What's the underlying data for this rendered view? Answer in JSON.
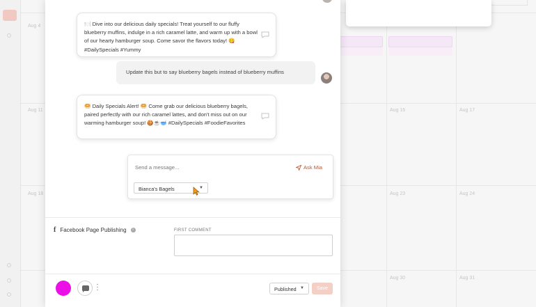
{
  "colors": {
    "accent": "#c0572f",
    "brand_circle": "#ea10e6",
    "save_disabled": "#f4cfc6"
  },
  "calendar": {
    "day_labels": [
      "Aug 4",
      "Aug 11",
      "Aug 16",
      "Aug 17",
      "Aug 18",
      "Aug 23",
      "Aug 24",
      "Aug 30",
      "Aug 31"
    ]
  },
  "chat": {
    "messages": [
      {
        "role": "assistant",
        "text": "🍽️ Dive into our delicious daily specials! Treat yourself to our fluffy blueberry muffins, indulge in a rich caramel latte, and warm up with a bowl of our hearty hamburger soup. Come savor the flavors today! 😋 #DailySpecials #Yummy"
      },
      {
        "role": "user",
        "text": "Update this but to say blueberry bagels instead of blueberry muffins"
      },
      {
        "role": "assistant",
        "text": "🥯 Daily Specials Alert! 🥯 Come grab our delicious blueberry bagels, paired perfectly with our rich caramel lattes, and don't miss out on our warming hamburger soup! 🍪☕🥣 #DailySpecials #FoodieFavorites"
      }
    ],
    "message_icon": "chat-bubble-icon"
  },
  "composer": {
    "placeholder": "Send a message...",
    "ask_label": "Ask Mia",
    "ask_icon": "send-icon",
    "brand_select": "Bianca's Bagels",
    "caret_icon": "chevron-down-icon"
  },
  "publishing": {
    "section_label": "Facebook Page Publishing",
    "section_icon": "facebook-icon",
    "info_icon": "info-icon",
    "first_comment_label": "FIRST COMMENT"
  },
  "footer": {
    "status": "Published",
    "save_label": "Save",
    "more_icon": "kebab-icon",
    "chat_icon": "chat-icon"
  }
}
